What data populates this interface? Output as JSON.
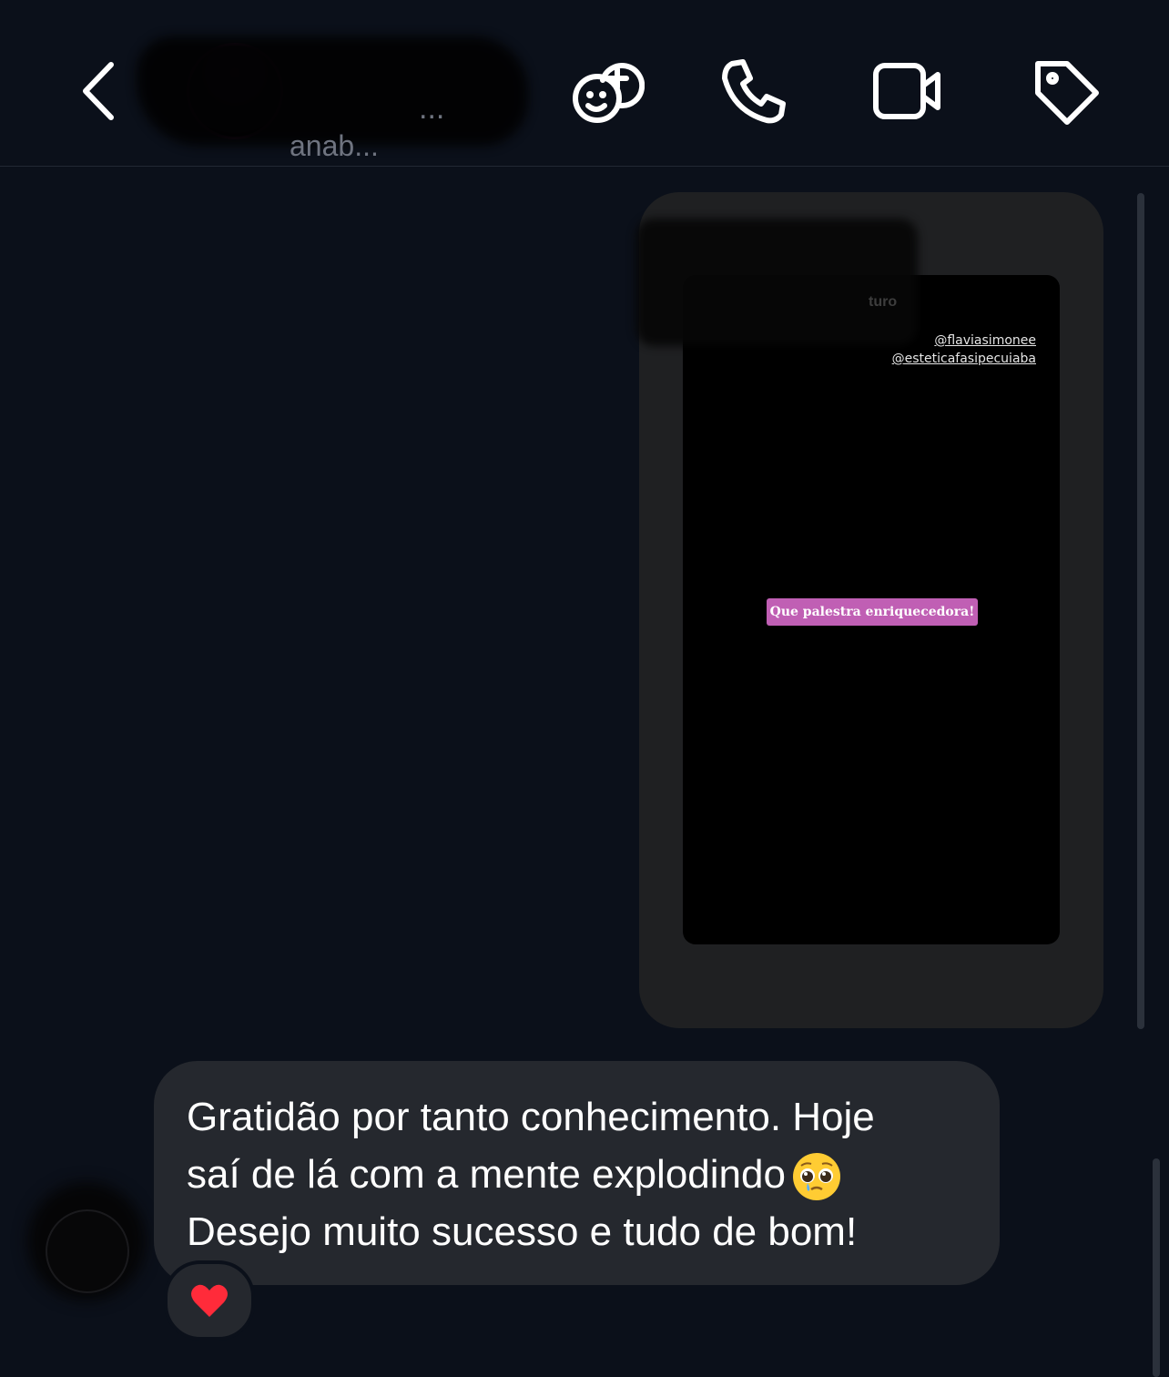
{
  "header": {
    "contact_name": "...",
    "contact_sub": "anab...",
    "actions": [
      "emoji-add",
      "call",
      "video-call",
      "tag"
    ]
  },
  "story_reply": {
    "username": "turo",
    "mentions": [
      "@flaviasimonee",
      "@esteticafasipecuiaba"
    ],
    "sticker_text": "Que palestra enriquecedora!"
  },
  "message": {
    "line1": "Gratidão por tanto conhecimento. Hoje",
    "line2": "saí de lá com a mente explodindo",
    "line3": "Desejo muito sucesso e tudo de bom!",
    "emoji": "pleading-face",
    "reaction": "❤"
  },
  "colors": {
    "background": "#0b101a",
    "bubble": "#25282e",
    "story_card": "#1f2022",
    "sticker": "#c05fb4",
    "reaction_heart": "#ff2b3a"
  }
}
